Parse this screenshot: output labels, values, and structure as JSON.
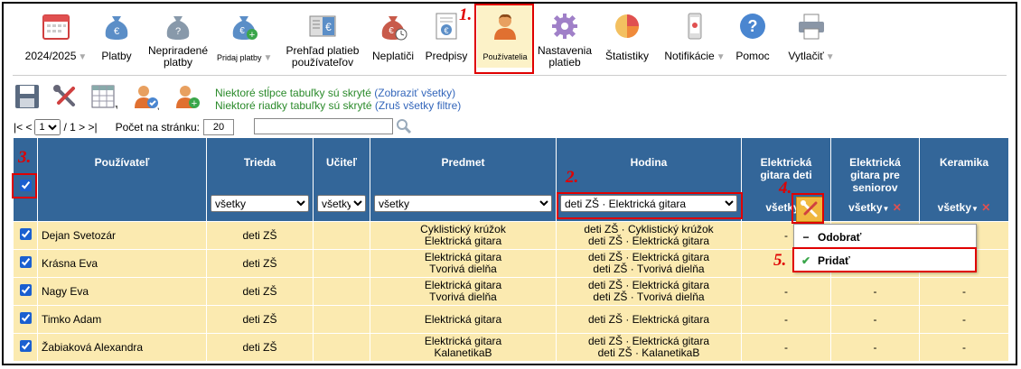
{
  "toolbar": {
    "year": "2024/2025",
    "items": [
      {
        "label": "Platby"
      },
      {
        "label": "Nepriradené\nplatby"
      },
      {
        "label": "Pridaj platby"
      },
      {
        "label": "Prehľad platieb\npoužívateľov"
      },
      {
        "label": "Neplatiči"
      },
      {
        "label": "Predpisy"
      },
      {
        "label": "Používatelia"
      },
      {
        "label": "Nastavenia\nplatieb"
      },
      {
        "label": "Štatistiky"
      },
      {
        "label": "Notifikácie"
      },
      {
        "label": "Pomoc"
      },
      {
        "label": "Vytlačiť"
      }
    ]
  },
  "steps": {
    "s1": "1.",
    "s2": "2.",
    "s3": "3.",
    "s4": "4.",
    "s5": "5."
  },
  "info": {
    "line1": "Niektoré stĺpce tabuľky sú skryté",
    "line1_link": "(Zobraziť všetky)",
    "line2": "Niektoré riadky tabuľky sú skryté",
    "line2_link": "(Zruš všetky filtre)"
  },
  "pager": {
    "first": "|< <",
    "page": "1",
    "of": "/ 1",
    "next": "> >|",
    "per_page_label": "Počet na stránku:",
    "per_page": "20"
  },
  "table": {
    "headers": {
      "user": "Používateľ",
      "class": "Trieda",
      "teacher": "Učiteľ",
      "subject": "Predmet",
      "lesson": "Hodina",
      "col1": "Elektrická\ngitara deti",
      "col2": "Elektrická\ngitara pre\nseniorov",
      "col3": "Keramika"
    },
    "filters": {
      "class": "všetky",
      "teacher": "všetky",
      "subject": "všetky",
      "lesson": "deti ZŠ · Elektrická gitara",
      "col1": "všetky",
      "col2": "všetky",
      "col3": "všetky"
    },
    "rows": [
      {
        "name": "Dejan Svetozár",
        "class": "deti ZŠ",
        "subject": "Cyklistický krúžok\nElektrická gitara",
        "lesson": "deti ZŠ · Cyklistický krúžok\ndeti ZŠ · Elektrická gitara",
        "c1": "-",
        "c2": "",
        "c3": ""
      },
      {
        "name": "Krásna Eva",
        "class": "deti ZŠ",
        "subject": "Elektrická gitara\nTvorivá dielňa",
        "lesson": "deti ZŠ · Elektrická gitara\ndeti ZŠ · Tvorivá dielňa",
        "c1": "",
        "c2": "",
        "c3": ""
      },
      {
        "name": "Nagy Eva",
        "class": "deti ZŠ",
        "subject": "Elektrická gitara\nTvorivá dielňa",
        "lesson": "deti ZŠ · Elektrická gitara\ndeti ZŠ · Tvorivá dielňa",
        "c1": "-",
        "c2": "-",
        "c3": "-"
      },
      {
        "name": "Timko Adam",
        "class": "deti ZŠ",
        "subject": "Elektrická gitara",
        "lesson": "deti ZŠ · Elektrická gitara",
        "c1": "-",
        "c2": "-",
        "c3": "-"
      },
      {
        "name": "Žabiaková Alexandra",
        "class": "deti ZŠ",
        "subject": "Elektrická gitara\nKalanetikaB",
        "lesson": "deti ZŠ · Elektrická gitara\ndeti ZŠ · KalanetikaB",
        "c1": "-",
        "c2": "-",
        "c3": "-"
      }
    ]
  },
  "menu": {
    "remove": "Odobrať",
    "add": "Pridať"
  },
  "colors": {
    "header_bg": "#336699",
    "row_bg": "#fbeab0",
    "highlight": "#e00000",
    "info_green": "#2a8a2a",
    "link_blue": "#3366bb"
  }
}
